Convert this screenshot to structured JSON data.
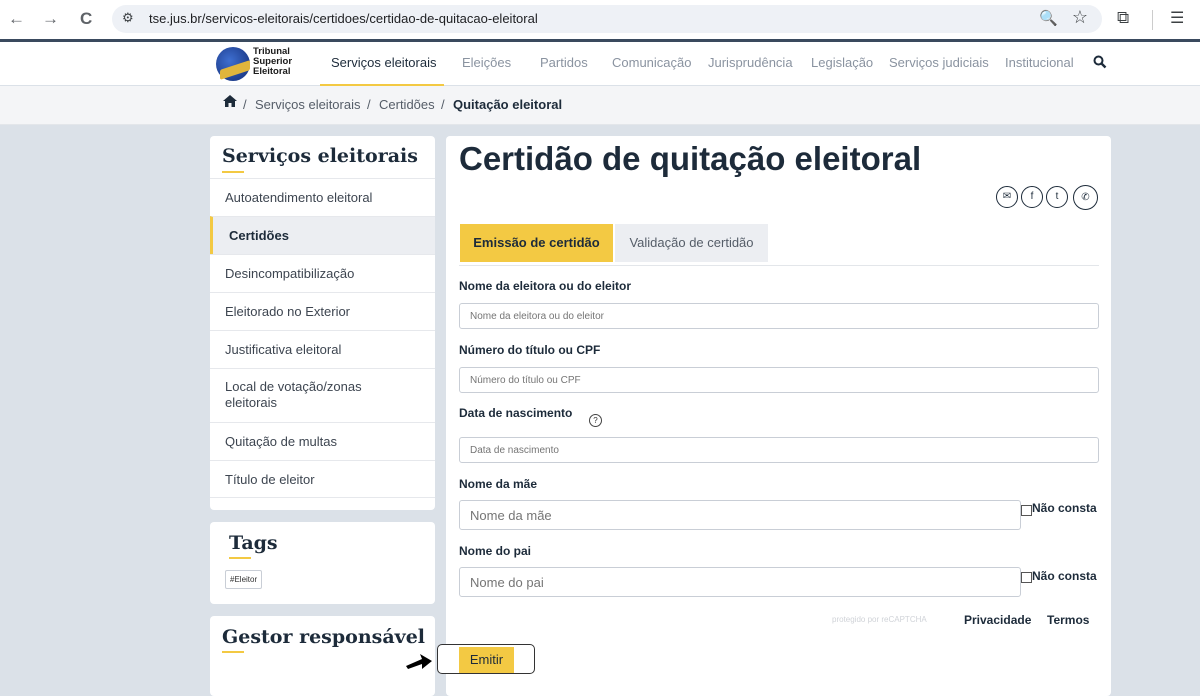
{
  "browser": {
    "back_icon": "←",
    "forward_icon": "→",
    "reload_icon": "C",
    "url": "tse.jus.br/servicos-eleitorais/certidoes/certidao-de-quitacao-eleitoral"
  },
  "site": {
    "logo_lines": [
      "Tribunal",
      "Superior",
      "Eleitoral"
    ],
    "menu": [
      "Serviços eleitorais",
      "Eleições",
      "Partidos",
      "Comunicação",
      "Jurisprudência",
      "Legislação",
      "Serviços judiciais",
      "Institucional"
    ],
    "menu_active": "Serviços eleitorais",
    "accent": "#f3c943",
    "dark": "#1d2b3a"
  },
  "breadcrumb": {
    "items": [
      "Serviços eleitorais",
      "Certidões",
      "Quitação eleitoral"
    ],
    "separator": "/"
  },
  "sidebar": {
    "title": "Serviços eleitorais",
    "items": [
      {
        "label": "Autoatendimento eleitoral"
      },
      {
        "label": "Certidões",
        "active": true
      },
      {
        "label": "Desincompatibilização"
      },
      {
        "label": "Eleitorado no Exterior"
      },
      {
        "label": "Justificativa eleitoral"
      },
      {
        "label": "Local de votação/zonas eleitorais"
      },
      {
        "label": "Quitação de multas"
      },
      {
        "label": "Título de eleitor"
      }
    ],
    "tags_title": "Tags",
    "tags": [
      "#Eleitor"
    ],
    "gestor_title": "Gestor responsável"
  },
  "main": {
    "title": "Certidão de quitação eleitoral",
    "share_icons": [
      "email-icon",
      "facebook-icon",
      "twitter-icon",
      "whatsapp-icon"
    ],
    "tabs": [
      {
        "label": "Emissão de certidão",
        "active": true
      },
      {
        "label": "Validação de certidão",
        "active": false
      }
    ],
    "fields": {
      "nome": {
        "label": "Nome da eleitora ou do eleitor",
        "placeholder": "Nome da eleitora ou do eleitor",
        "value": ""
      },
      "titulo": {
        "label": "Número do título ou CPF",
        "placeholder": "Número do título ou CPF",
        "value": ""
      },
      "nascimento": {
        "label": "Data de nascimento",
        "placeholder": "Data de nascimento",
        "value": ""
      },
      "mae": {
        "label": "Nome da mãe",
        "placeholder": "Nome da mãe",
        "value": "",
        "nao_consta_label": "Não consta"
      },
      "pai": {
        "label": "Nome do pai",
        "placeholder": "Nome do pai",
        "value": "",
        "nao_consta_label": "Não consta"
      }
    },
    "recaptcha": {
      "text": "protegido por reCAPTCHA",
      "privacy": "Privacidade",
      "terms": "Termos"
    },
    "submit_label": "Emitir"
  }
}
